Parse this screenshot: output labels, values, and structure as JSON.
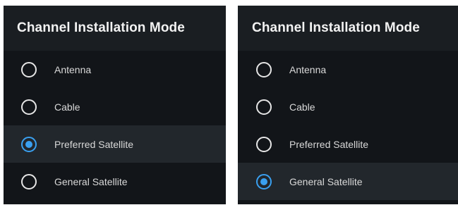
{
  "colors": {
    "panel_background": "#121519",
    "header_background": "#1a1e22",
    "selected_row_background": "#22272c",
    "radio_accent": "#3aa0f0",
    "text": "#d9d9d9"
  },
  "panels": [
    {
      "title": "Channel Installation Mode",
      "options": [
        {
          "label": "Antenna",
          "selected": false,
          "icon": "radio-unchecked-icon"
        },
        {
          "label": "Cable",
          "selected": false,
          "icon": "radio-unchecked-icon"
        },
        {
          "label": "Preferred Satellite",
          "selected": true,
          "icon": "radio-checked-icon"
        },
        {
          "label": "General Satellite",
          "selected": false,
          "icon": "radio-unchecked-icon"
        }
      ]
    },
    {
      "title": "Channel Installation Mode",
      "options": [
        {
          "label": "Antenna",
          "selected": false,
          "icon": "radio-unchecked-icon"
        },
        {
          "label": "Cable",
          "selected": false,
          "icon": "radio-unchecked-icon"
        },
        {
          "label": "Preferred Satellite",
          "selected": false,
          "icon": "radio-unchecked-icon"
        },
        {
          "label": "General Satellite",
          "selected": true,
          "icon": "radio-checked-icon"
        }
      ]
    }
  ]
}
